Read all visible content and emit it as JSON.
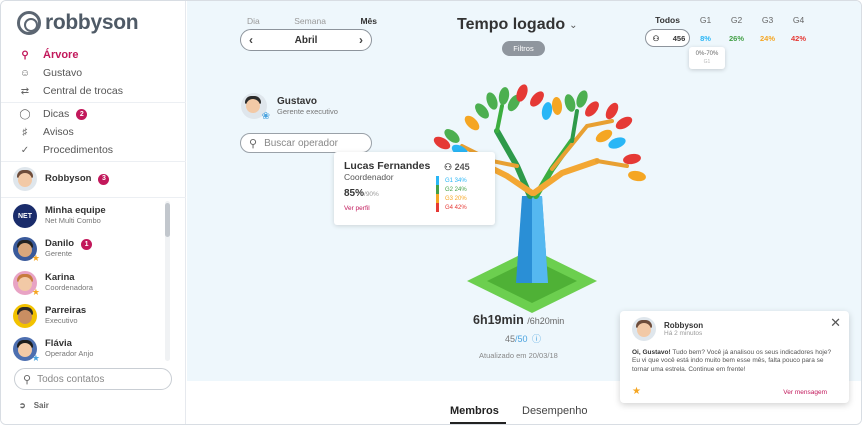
{
  "app": {
    "logo_text": "robbyson"
  },
  "nav": {
    "items": [
      {
        "icon": "tree-icon",
        "label": "Árvore",
        "active": true
      },
      {
        "icon": "user-icon",
        "label": "Gustavo"
      },
      {
        "icon": "exchange-icon",
        "label": "Central de trocas"
      },
      {
        "icon": "bulb-icon",
        "label": "Dicas",
        "badge": "2"
      },
      {
        "icon": "bell-icon",
        "label": "Avisos"
      },
      {
        "icon": "check-circle-icon",
        "label": "Procedimentos"
      }
    ]
  },
  "contacts": {
    "robbyson": {
      "name": "Robbyson",
      "badge": "3"
    },
    "list": [
      {
        "name": "Minha equipe",
        "role": "Net Multi Combo",
        "avatar": "NET"
      },
      {
        "name": "Danilo",
        "role": "Gerente",
        "badge": "1"
      },
      {
        "name": "Karina",
        "role": "Coordenadora"
      },
      {
        "name": "Parreiras",
        "role": "Executivo"
      },
      {
        "name": "Flávia",
        "role": "Operador Anjo"
      }
    ],
    "search_placeholder": "Todos contatos"
  },
  "logout_label": "Sair",
  "period": {
    "options": [
      "Dia",
      "Semana",
      "Mês"
    ],
    "selected": "Mês",
    "value": "Abril"
  },
  "header": {
    "title": "Tempo logado",
    "filters_label": "Filtros"
  },
  "groups": {
    "all_label": "Todos",
    "all_count": "456",
    "columns": [
      {
        "label": "G1",
        "value": "8%",
        "color": "#29b6f6"
      },
      {
        "label": "G2",
        "value": "26%",
        "color": "#43a047"
      },
      {
        "label": "G3",
        "value": "24%",
        "color": "#f5a623"
      },
      {
        "label": "G4",
        "value": "42%",
        "color": "#e53935"
      }
    ],
    "tooltip": {
      "range": "0%-70%",
      "sub": "G1"
    }
  },
  "user": {
    "name": "Gustavo",
    "role": "Gerente executivo"
  },
  "operator_search_placeholder": "Buscar operador",
  "operator_card": {
    "name": "Lucas Fernandes",
    "role": "Coordenador",
    "percent": "85%",
    "percent_target": "/90%",
    "link": "Ver perfil",
    "count": "245",
    "groups": [
      {
        "label": "G1 34%",
        "color": "#29b6f6"
      },
      {
        "label": "G2 24%",
        "color": "#43a047"
      },
      {
        "label": "G3 20%",
        "color": "#f5a623"
      },
      {
        "label": "G4 42%",
        "color": "#e53935"
      }
    ]
  },
  "summary": {
    "time": "6h19min",
    "target": "/6h20min",
    "score": "45",
    "score_total": "/50",
    "updated": "Atualizado em 20/03/18"
  },
  "tabs": [
    {
      "label": "Membros",
      "selected": true
    },
    {
      "label": "Desempenho"
    }
  ],
  "notification": {
    "name": "Robbyson",
    "time": "Há 2 minutos",
    "greeting": "Oi, Gustavo!",
    "message": "Tudo bem? Você já analisou os seus indicadores hoje? Eu vi que você está indo muito bem esse mês, falta pouco para se tornar uma estrela. Continue em frente!",
    "link": "Ver mensagem"
  }
}
